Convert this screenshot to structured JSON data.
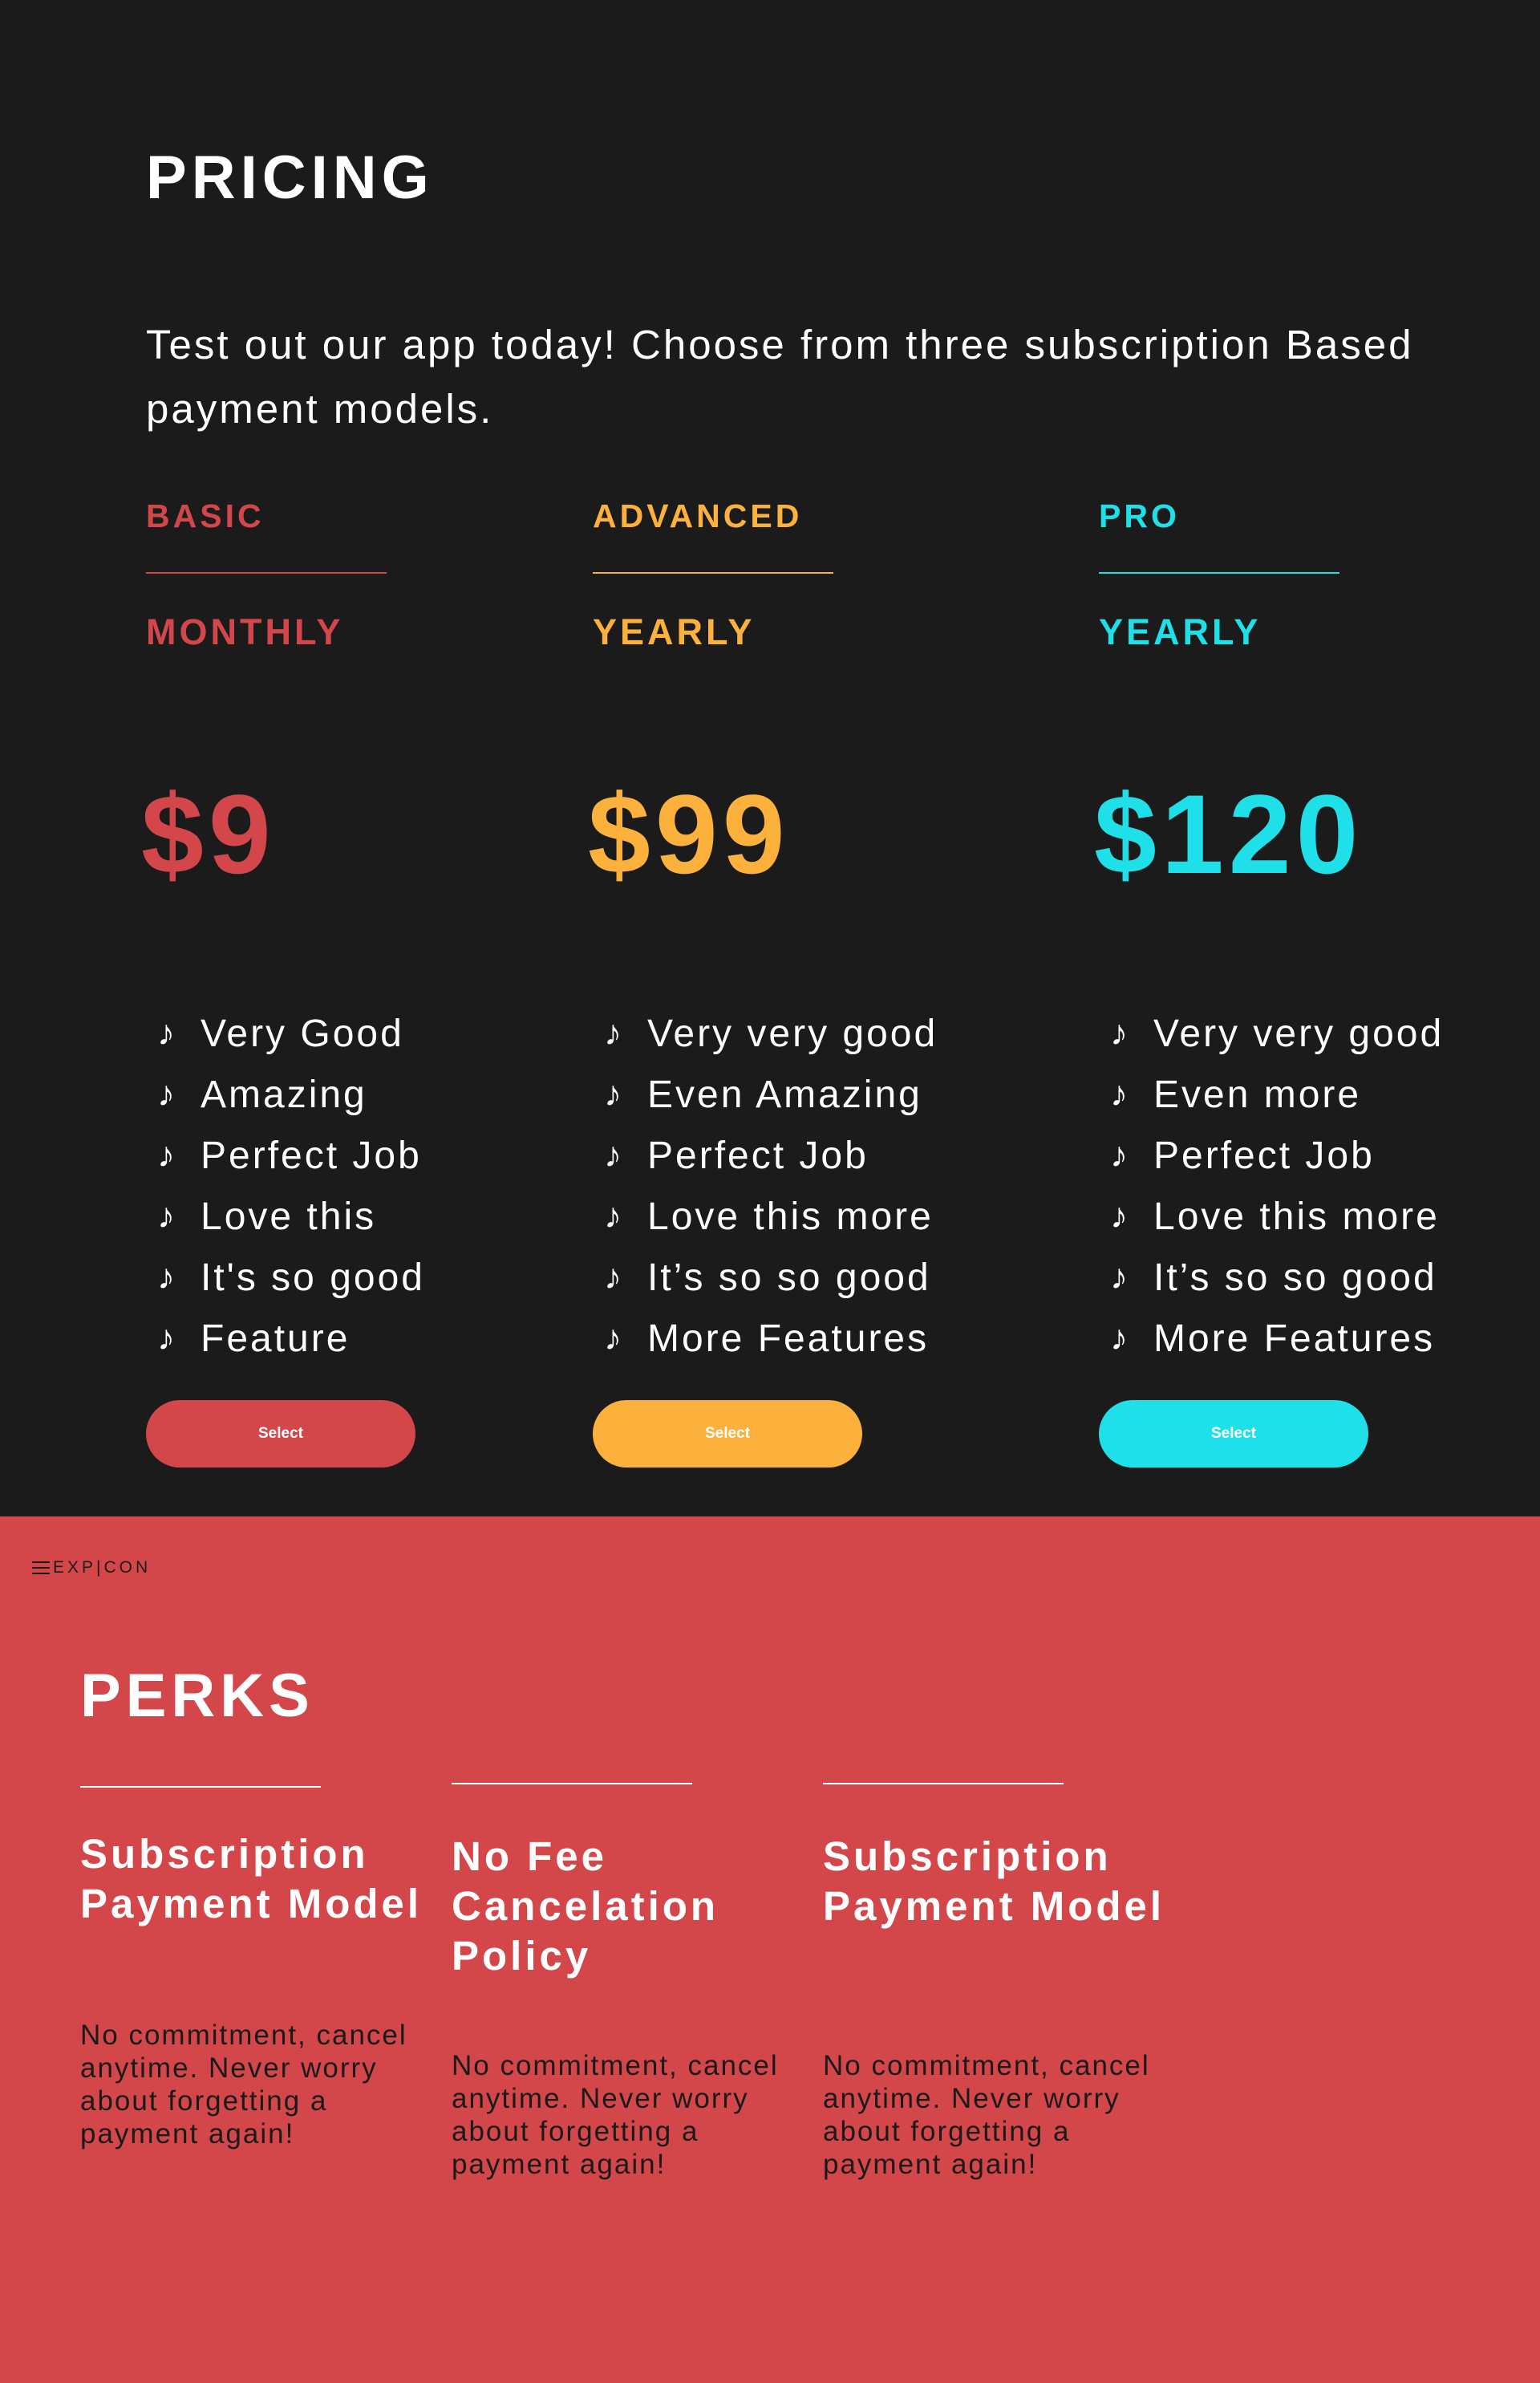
{
  "colors": {
    "dark_bg": "#1b1b1c",
    "perks_bg": "#d3474b",
    "basic": "#d3474b",
    "advanced": "#fdb13d",
    "pro": "#1fe0e8",
    "text_light": "#ffffff",
    "text_dark": "#1a1a1a"
  },
  "logo": {
    "text": "EXP|CON",
    "menu_icon": "hamburger-icon"
  },
  "pricing": {
    "title": "PRICING",
    "intro": "Test out our app today! Choose from three subscription Based payment models.",
    "plans": [
      {
        "name": "BASIC",
        "period": "MONTHLY",
        "price": "$9",
        "features": [
          "Very Good",
          "Amazing",
          "Perfect Job",
          "Love this",
          "It's so good",
          "Feature"
        ],
        "button_label": "Select"
      },
      {
        "name": "ADVANCED",
        "period": "YEARLY",
        "price": "$99",
        "features": [
          "Very very good",
          "Even Amazing",
          "Perfect Job",
          "Love this more",
          "It’s so so good",
          "More Features"
        ],
        "button_label": "Select"
      },
      {
        "name": "PRO",
        "period": "YEARLY",
        "price": "$120",
        "features": [
          "Very very good",
          "Even more",
          "Perfect Job",
          "Love this more",
          "It’s so so good",
          "More Features"
        ],
        "button_label": "Select"
      }
    ],
    "feature_icon": "music-note-icon"
  },
  "perks": {
    "title": "PERKS",
    "items": [
      {
        "title": "Subscription Payment Model",
        "body": "No commitment, cancel anytime. Never worry about forgetting a payment again!"
      },
      {
        "title": "No Fee Cancelation Policy",
        "body": "No commitment, cancel anytime. Never worry about forgetting a payment again!"
      },
      {
        "title": "Subscription Payment Model",
        "body": "No commitment, cancel anytime. Never worry about forgetting a payment again!"
      }
    ]
  }
}
